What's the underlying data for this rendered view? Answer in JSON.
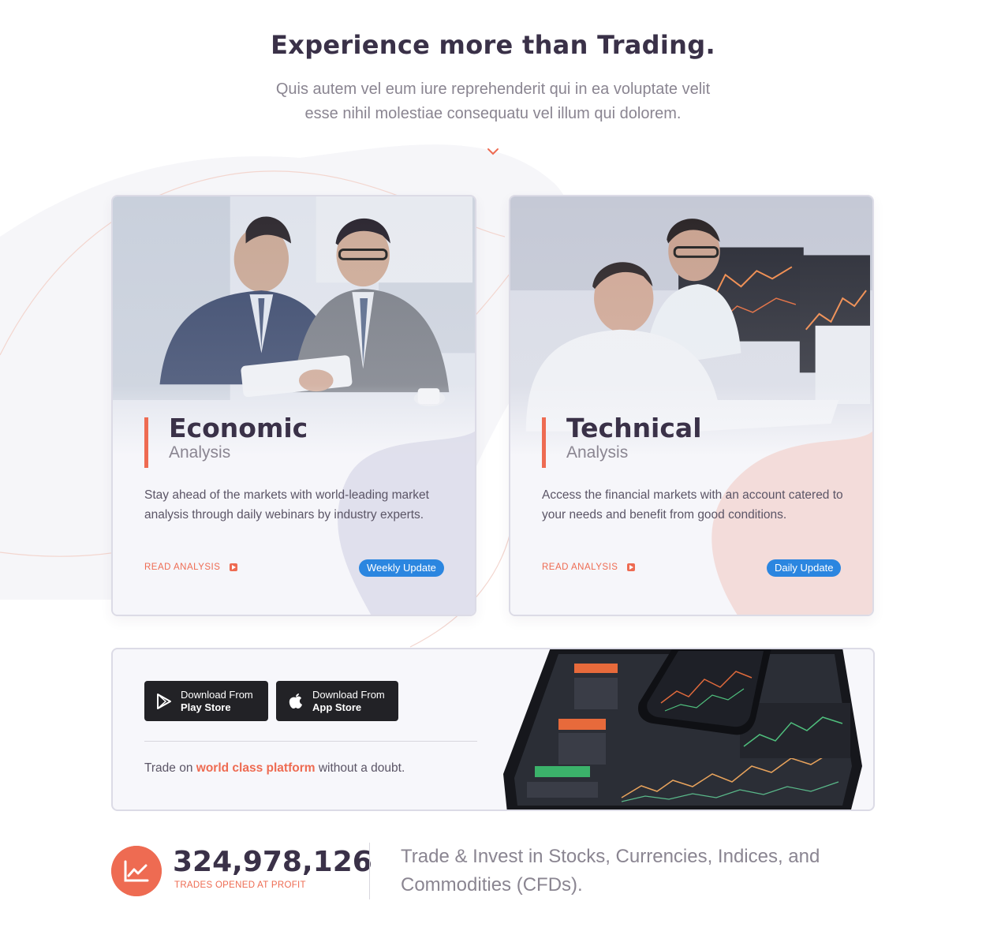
{
  "header": {
    "title": "Experience more than Trading.",
    "subtitle": "Quis autem vel eum iure reprehenderit qui in ea voluptate velit esse nihil molestiae consequatu vel illum qui dolorem."
  },
  "cards": [
    {
      "title": "Economic",
      "kicker": "Analysis",
      "description": "Stay ahead of the markets with world-leading market analysis through daily webinars by industry experts.",
      "link_label": "READ ANALYSIS",
      "badge": "Weekly Update"
    },
    {
      "title": "Technical",
      "kicker": "Analysis",
      "description": "Access the financial markets with an account catered to your needs and benefit from good conditions.",
      "link_label": "READ ANALYSIS",
      "badge": "Daily Update"
    }
  ],
  "apps": {
    "play_store": {
      "line1": "Download From",
      "line2": "Play Store"
    },
    "app_store": {
      "line1": "Download From",
      "line2": "App Store"
    },
    "tagline_prefix": "Trade on ",
    "tagline_highlight": "world class platform",
    "tagline_suffix": " without a doubt."
  },
  "stats": {
    "number": "324,978,126",
    "label": "TRADES OPENED AT PROFIT",
    "description": "Trade & Invest in Stocks, Currencies, Indices, and Commodities (CFDs)."
  },
  "colors": {
    "accent": "#ee6b52",
    "badge": "#2b86e0",
    "heading": "#3a3148",
    "muted": "#8a8591"
  },
  "icons": [
    "chevron-down-icon",
    "play-store-icon",
    "apple-icon",
    "chart-trend-icon",
    "arrow-play-icon"
  ]
}
